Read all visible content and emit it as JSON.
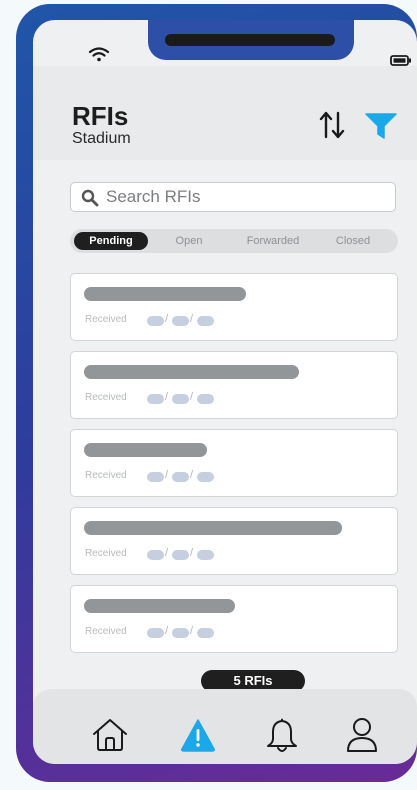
{
  "header": {
    "title": "RFIs",
    "subtitle": "Stadium"
  },
  "icons": {
    "wifi": "wifi-icon",
    "battery": "battery-icon",
    "sort": "sort-arrows-icon",
    "filter": "filter-funnel-icon",
    "search": "search-icon",
    "home": "home-icon",
    "alert": "alert-triangle-icon",
    "notifications": "bell-icon",
    "profile": "user-icon"
  },
  "colors": {
    "accent": "#1aa8e8",
    "frame_start": "#1f56a8",
    "frame_end": "#6a2a98",
    "active_tab": "#1f1f1f"
  },
  "search": {
    "placeholder": "Search RFIs",
    "value": ""
  },
  "tabs": [
    {
      "label": "Pending",
      "active": true
    },
    {
      "label": "Open",
      "active": false
    },
    {
      "label": "Forwarded",
      "active": false
    },
    {
      "label": "Closed",
      "active": false
    }
  ],
  "list": {
    "items": [
      {
        "received_label": "Received",
        "date_separators": [
          "/",
          "/"
        ]
      },
      {
        "received_label": "Received",
        "date_separators": [
          "/",
          "/"
        ]
      },
      {
        "received_label": "Received",
        "date_separators": [
          "/",
          "/"
        ]
      },
      {
        "received_label": "Received",
        "date_separators": [
          "/",
          "/"
        ]
      },
      {
        "received_label": "Received",
        "date_separators": [
          "/",
          "/"
        ]
      }
    ]
  },
  "footer": {
    "count": "5 RFIs"
  },
  "nav": {
    "active": "alert"
  }
}
